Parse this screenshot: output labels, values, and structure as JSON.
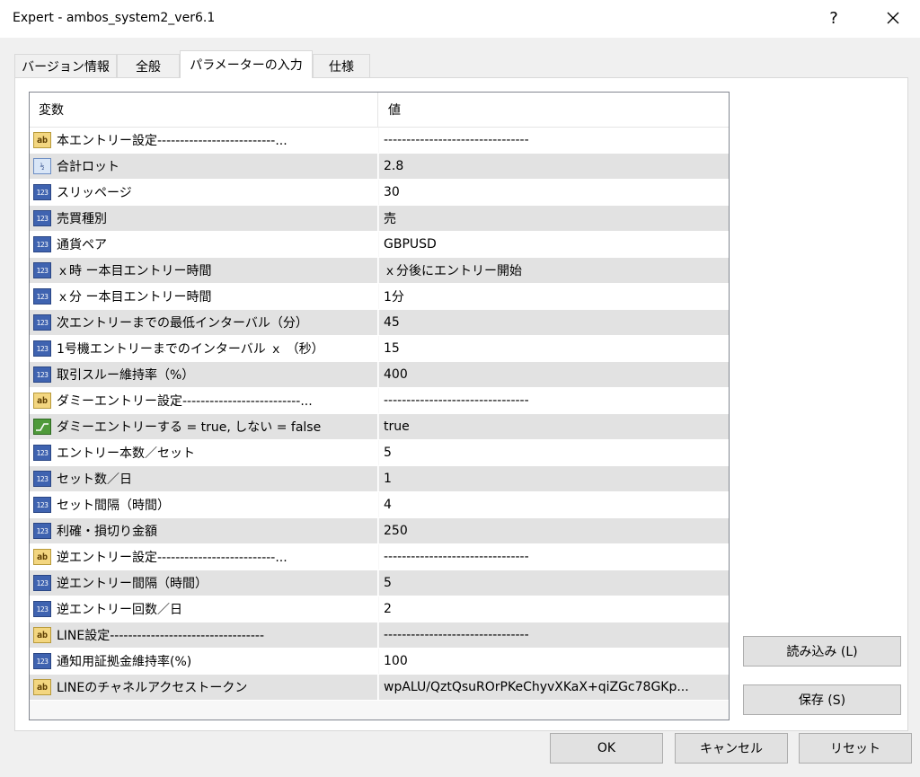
{
  "window": {
    "title": "Expert - ambos_system2_ver6.1",
    "help": "?",
    "close": "✕"
  },
  "tabs": [
    {
      "label": "バージョン情報",
      "active": false
    },
    {
      "label": "全般",
      "active": false
    },
    {
      "label": "パラメーターの入力",
      "active": true
    },
    {
      "label": "仕様",
      "active": false
    }
  ],
  "grid": {
    "header": {
      "variable": "変数",
      "value": "値"
    },
    "rows": [
      {
        "type": "str",
        "icon": "ab",
        "name": "本エントリー設定--------------------------...",
        "value": "--------------------------------"
      },
      {
        "type": "dbl",
        "icon": "½",
        "name": "合計ロット",
        "value": "2.8"
      },
      {
        "type": "int",
        "icon": "123",
        "name": "スリッページ",
        "value": "30"
      },
      {
        "type": "int",
        "icon": "123",
        "name": "売買種別",
        "value": "売"
      },
      {
        "type": "int",
        "icon": "123",
        "name": "通貨ペア",
        "value": "GBPUSD"
      },
      {
        "type": "int",
        "icon": "123",
        "name": "ｘ時 ー本目エントリー時間",
        "value": "ｘ分後にエントリー開始"
      },
      {
        "type": "int",
        "icon": "123",
        "name": "ｘ分 ー本目エントリー時間",
        "value": "1分"
      },
      {
        "type": "int",
        "icon": "123",
        "name": "次エントリーまでの最低インターバル（分）",
        "value": "45"
      },
      {
        "type": "int",
        "icon": "123",
        "name": "1号機エントリーまでのインターバル ｘ （秒）",
        "value": "15"
      },
      {
        "type": "int",
        "icon": "123",
        "name": "取引スルー維持率（%）",
        "value": "400"
      },
      {
        "type": "str",
        "icon": "ab",
        "name": "ダミーエントリー設定--------------------------...",
        "value": "--------------------------------"
      },
      {
        "type": "bool",
        "icon": "",
        "name": "ダミーエントリーする = true, しない = false",
        "value": "true"
      },
      {
        "type": "int",
        "icon": "123",
        "name": "エントリー本数／セット",
        "value": "5"
      },
      {
        "type": "int",
        "icon": "123",
        "name": "セット数／日",
        "value": "1"
      },
      {
        "type": "int",
        "icon": "123",
        "name": "セット間隔（時間）",
        "value": "4"
      },
      {
        "type": "int",
        "icon": "123",
        "name": "利確・損切り金額",
        "value": "250"
      },
      {
        "type": "str",
        "icon": "ab",
        "name": "逆エントリー設定--------------------------...",
        "value": "--------------------------------"
      },
      {
        "type": "int",
        "icon": "123",
        "name": "逆エントリー間隔（時間）",
        "value": "5"
      },
      {
        "type": "int",
        "icon": "123",
        "name": "逆エントリー回数／日",
        "value": "2"
      },
      {
        "type": "str",
        "icon": "ab",
        "name": "LINE設定----------------------------------",
        "value": "--------------------------------"
      },
      {
        "type": "int",
        "icon": "123",
        "name": "通知用証拠金維持率(%)",
        "value": "100"
      },
      {
        "type": "str",
        "icon": "ab",
        "name": "LINEのチャネルアクセストークン",
        "value": "wpALU/QztQsuROrPKeChyvXKaX+qiZGc78GKp..."
      }
    ]
  },
  "buttons": {
    "load": "読み込み (L)",
    "save": "保存 (S)",
    "ok": "OK",
    "cancel": "キャンセル",
    "reset": "リセット"
  },
  "colors": {
    "int_icon": "#3f63b0",
    "str_icon": "#f3d680",
    "bool_icon": "#4f9a3a",
    "focus_border": "#0078d7"
  }
}
